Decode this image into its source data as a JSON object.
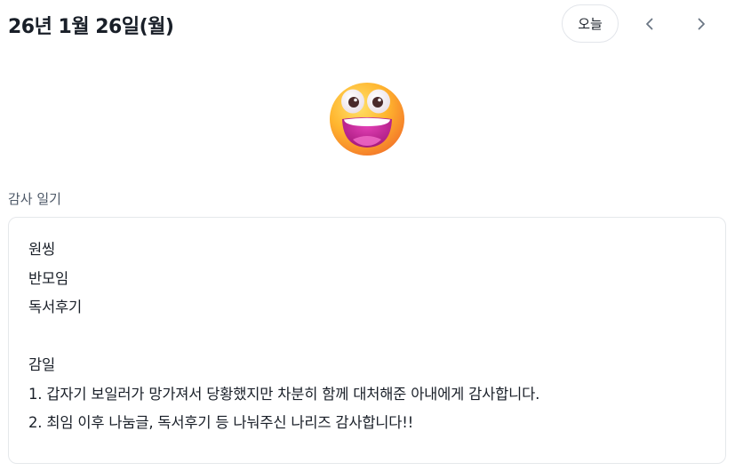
{
  "header": {
    "date_title": "26년 1월 26일(월)",
    "today_label": "오늘",
    "prev_icon": "chevron-left-icon",
    "next_icon": "chevron-right-icon"
  },
  "mood": {
    "icon": "grinning-face-emoji-icon"
  },
  "diary": {
    "section_label": "감사 일기",
    "content": "원씽\n반모임\n독서후기\n\n감일\n1. 갑자기 보일러가 망가져서 당황했지만 차분히 함께 대처해준 아내에게 감사합니다.\n2. 최임 이후 나눔글, 독서후기 등 나눠주신 나리즈 감사합니다!!"
  },
  "colors": {
    "text_primary": "#191f28",
    "text_secondary": "#4e5968",
    "border": "#e5e8eb",
    "emoji_face": "#ffb02e",
    "emoji_mouth": "#c51b8a"
  }
}
